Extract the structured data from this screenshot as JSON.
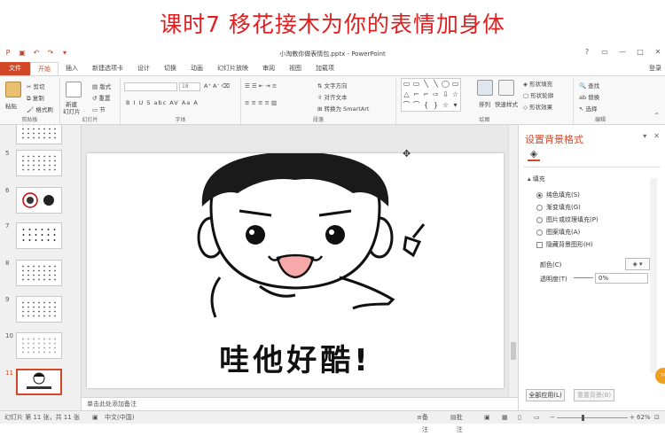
{
  "banner": {
    "caption": "课时7 移花接木为你的表情加身体"
  },
  "titlebar": {
    "doc_title": "小淘教你做表情包.pptx - PowerPoint"
  },
  "tabs": [
    {
      "label": "文件"
    },
    {
      "label": "开始"
    },
    {
      "label": "插入"
    },
    {
      "label": "新建选项卡"
    },
    {
      "label": "设计"
    },
    {
      "label": "切换"
    },
    {
      "label": "动画"
    },
    {
      "label": "幻灯片放映"
    },
    {
      "label": "审阅"
    },
    {
      "label": "视图"
    },
    {
      "label": "加载项"
    }
  ],
  "login": "登录",
  "ribbon": {
    "clipboard": {
      "paste": "粘贴",
      "cut": "剪切",
      "copy": "复制",
      "format_painter": "格式刷",
      "label": "剪贴板"
    },
    "slides": {
      "new_slide": "新建",
      "new_slide2": "幻灯片",
      "layout": "版式",
      "reset": "重置",
      "section": "节",
      "label": "幻灯片"
    },
    "font": {
      "size": "18",
      "label": "字体",
      "styles": "B  I  U  S  abc  AV  Aa  A"
    },
    "paragraph": {
      "text_direction": "文字方向",
      "align_text": "对齐文本",
      "smartart": "转换为 SmartArt",
      "label": "段落"
    },
    "drawing": {
      "arrange": "排列",
      "quick_styles": "快速样式",
      "shape_fill": "形状填充",
      "shape_outline": "形状轮廓",
      "shape_effects": "形状效果",
      "label": "绘图"
    },
    "editing": {
      "find": "查找",
      "replace": "替换",
      "select": "选择",
      "label": "编辑"
    }
  },
  "thumbnails": [
    {
      "num": "5"
    },
    {
      "num": "6"
    },
    {
      "num": "7"
    },
    {
      "num": "8"
    },
    {
      "num": "9"
    },
    {
      "num": "10"
    },
    {
      "num": "11"
    }
  ],
  "slide": {
    "caption": "哇他好酷!"
  },
  "notes": {
    "placeholder": "单击此处添加备注"
  },
  "pane": {
    "title": "设置背景格式",
    "fill_section": "填充",
    "options": [
      {
        "label": "纯色填充(S)",
        "selected": true
      },
      {
        "label": "渐变填充(G)",
        "selected": false
      },
      {
        "label": "图片或纹理填充(P)",
        "selected": false
      },
      {
        "label": "图案填充(A)",
        "selected": false
      }
    ],
    "hide_bg": "隐藏背景图形(H)",
    "color_label": "颜色(C)",
    "transparency_label": "透明度(T)",
    "transparency_value": "0%",
    "apply_all": "全部应用(L)",
    "reset_bg": "重置背景(B)"
  },
  "status": {
    "slide_info": "幻灯片 第 11 张，共 11 张",
    "language": "中文(中国)",
    "notes": "备注",
    "comments": "批注",
    "zoom": "62%"
  },
  "colors": {
    "accent": "#d24726",
    "banner_text": "#e02020"
  }
}
